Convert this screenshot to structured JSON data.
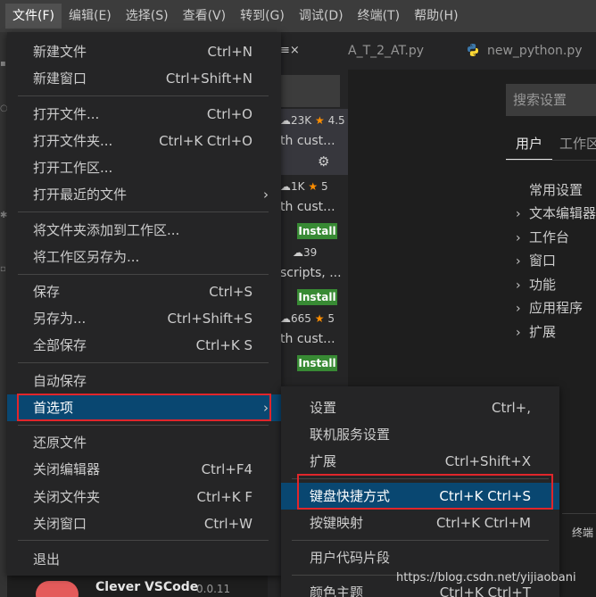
{
  "menubar": {
    "items": [
      {
        "label": "文件(F)"
      },
      {
        "label": "编辑(E)"
      },
      {
        "label": "选择(S)"
      },
      {
        "label": "查看(V)"
      },
      {
        "label": "转到(G)"
      },
      {
        "label": "调试(D)"
      },
      {
        "label": "终端(T)"
      },
      {
        "label": "帮助(H)"
      }
    ]
  },
  "tabs": [
    {
      "label": "A_T_2_AT.py"
    },
    {
      "label": "new_python.py"
    }
  ],
  "extensions": {
    "rows": [
      {
        "downloads": "23K",
        "rating": "4.5",
        "desc": "th cust...",
        "action": "gear"
      },
      {
        "downloads": "1K",
        "rating": "5",
        "desc": "th cust...",
        "action": "Install"
      },
      {
        "downloads": "39",
        "rating": "",
        "desc": "scripts, ...",
        "action": "Install"
      },
      {
        "downloads": "665",
        "rating": "5",
        "desc": "th cust...",
        "action": "Install"
      }
    ],
    "bottom_item": {
      "name": "Clever VSCode",
      "version": "0.0.11"
    }
  },
  "settings": {
    "search_placeholder": "搜索设置",
    "tabs": [
      "用户",
      "工作区"
    ],
    "tree": [
      {
        "label": "常用设置",
        "expandable": false
      },
      {
        "label": "文本编辑器",
        "expandable": true
      },
      {
        "label": "工作台",
        "expandable": true
      },
      {
        "label": "窗口",
        "expandable": true
      },
      {
        "label": "功能",
        "expandable": true
      },
      {
        "label": "应用程序",
        "expandable": true
      },
      {
        "label": "扩展",
        "expandable": true
      }
    ]
  },
  "bottom_panel": {
    "label": "终端"
  },
  "file_menu": {
    "items": [
      {
        "label": "新建文件",
        "shortcut": "Ctrl+N"
      },
      {
        "label": "新建窗口",
        "shortcut": "Ctrl+Shift+N"
      },
      {
        "label": "打开文件...",
        "shortcut": "Ctrl+O"
      },
      {
        "label": "打开文件夹...",
        "shortcut": "Ctrl+K Ctrl+O"
      },
      {
        "label": "打开工作区...",
        "shortcut": ""
      },
      {
        "label": "打开最近的文件",
        "shortcut": ""
      },
      {
        "label": "将文件夹添加到工作区...",
        "shortcut": ""
      },
      {
        "label": "将工作区另存为...",
        "shortcut": ""
      },
      {
        "label": "保存",
        "shortcut": "Ctrl+S"
      },
      {
        "label": "另存为...",
        "shortcut": "Ctrl+Shift+S"
      },
      {
        "label": "全部保存",
        "shortcut": "Ctrl+K S"
      },
      {
        "label": "自动保存",
        "shortcut": ""
      },
      {
        "label": "首选项",
        "shortcut": ""
      },
      {
        "label": "还原文件",
        "shortcut": ""
      },
      {
        "label": "关闭编辑器",
        "shortcut": "Ctrl+F4"
      },
      {
        "label": "关闭文件夹",
        "shortcut": "Ctrl+K F"
      },
      {
        "label": "关闭窗口",
        "shortcut": "Ctrl+W"
      },
      {
        "label": "退出",
        "shortcut": ""
      }
    ]
  },
  "preferences_menu": {
    "items": [
      {
        "label": "设置",
        "shortcut": "Ctrl+,"
      },
      {
        "label": "联机服务设置",
        "shortcut": ""
      },
      {
        "label": "扩展",
        "shortcut": "Ctrl+Shift+X"
      },
      {
        "label": "键盘快捷方式",
        "shortcut": "Ctrl+K Ctrl+S"
      },
      {
        "label": "按键映射",
        "shortcut": "Ctrl+K Ctrl+M"
      },
      {
        "label": "用户代码片段",
        "shortcut": ""
      },
      {
        "label": "颜色主题",
        "shortcut": "Ctrl+K Ctrl+T"
      }
    ]
  },
  "watermark": "https://blog.csdn.net/yijiaobani",
  "colors": {
    "menu_bg": "#252526",
    "highlight": "#094771",
    "annotation_box": "#e0262b",
    "install_button": "#388a34",
    "star": "#ff8e00"
  }
}
